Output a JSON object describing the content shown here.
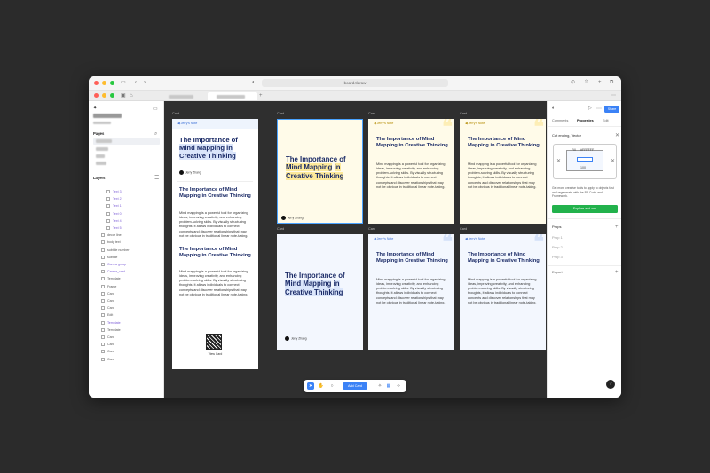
{
  "browser": {
    "url": "board.tldraw",
    "tabs": [
      {
        "label": ""
      },
      {
        "label": ""
      }
    ]
  },
  "left_panel": {
    "pages_title": "Pages",
    "layers_title": "Layers",
    "layers": [
      {
        "label": "Text 3",
        "purple": true
      },
      {
        "label": "Text 2",
        "purple": true
      },
      {
        "label": "Text 1",
        "purple": true
      },
      {
        "label": "Text 0",
        "purple": true
      },
      {
        "label": "Text 4",
        "purple": true
      },
      {
        "label": "Text 5",
        "purple": true
      },
      {
        "label": "decor line",
        "purple": false
      },
      {
        "label": "body text",
        "purple": false
      },
      {
        "label": "subtitle number",
        "purple": false
      },
      {
        "label": "subtitle",
        "purple": false
      },
      {
        "label": "Carrea group",
        "purple": true
      },
      {
        "label": "Carrea_card",
        "purple": true
      },
      {
        "label": "Template",
        "purple": false
      },
      {
        "label": "Frame",
        "purple": false
      },
      {
        "label": "Card",
        "purple": false
      },
      {
        "label": "Card",
        "purple": false
      },
      {
        "label": "Card",
        "purple": false
      },
      {
        "label": "Edit",
        "purple": false
      },
      {
        "label": "Template",
        "purple": true
      },
      {
        "label": "Template",
        "purple": false
      },
      {
        "label": "Card",
        "purple": false
      },
      {
        "label": "Card",
        "purple": false
      },
      {
        "label": "Card",
        "purple": false
      },
      {
        "label": "Card",
        "purple": false
      }
    ]
  },
  "canvas": {
    "frame_label": "Card",
    "header_text": "Jerry’s Note",
    "title_part1": "The Importance of",
    "title_part2": "Mind Mapping",
    "title_part3": "in Creative Thinking",
    "section_title": "The Importance of Mind Mapping in Creative Thinking",
    "body_text": "Mind mapping is a powerful tool for organizing ideas, improving creativity, and enhancing problem-solving skills. By visually structuring thoughts, it allows individuals to connect concepts and discover relationships that may not be obvious in traditional linear note-taking.",
    "author": "Jerry Zhang",
    "qr_caption": "View Card"
  },
  "toolbar": {
    "add_label": "Add Card"
  },
  "right_panel": {
    "tabs": [
      "Comments",
      "Properties",
      "Edit"
    ],
    "share_label": "Share",
    "section_title": "Cut ending, Vector",
    "fill_label": "Fill",
    "fill_value": "#FFFFFF",
    "percent": "100",
    "description": "Get more creative tools to apply to objects fast and regenerate with the PS Code and Framework.",
    "cta_label": "Explore add-ons",
    "props_title": "Props",
    "props": [
      "Prop 1",
      "Prop 2",
      "Prop 3"
    ],
    "export_title": "Export",
    "help": "?"
  },
  "colors": {
    "accent": "#3b82f6",
    "green": "#22b24c",
    "highlight_yellow": "#fde99a",
    "highlight_blue": "#dbe6fb",
    "canvas": "#2f2f2f"
  }
}
